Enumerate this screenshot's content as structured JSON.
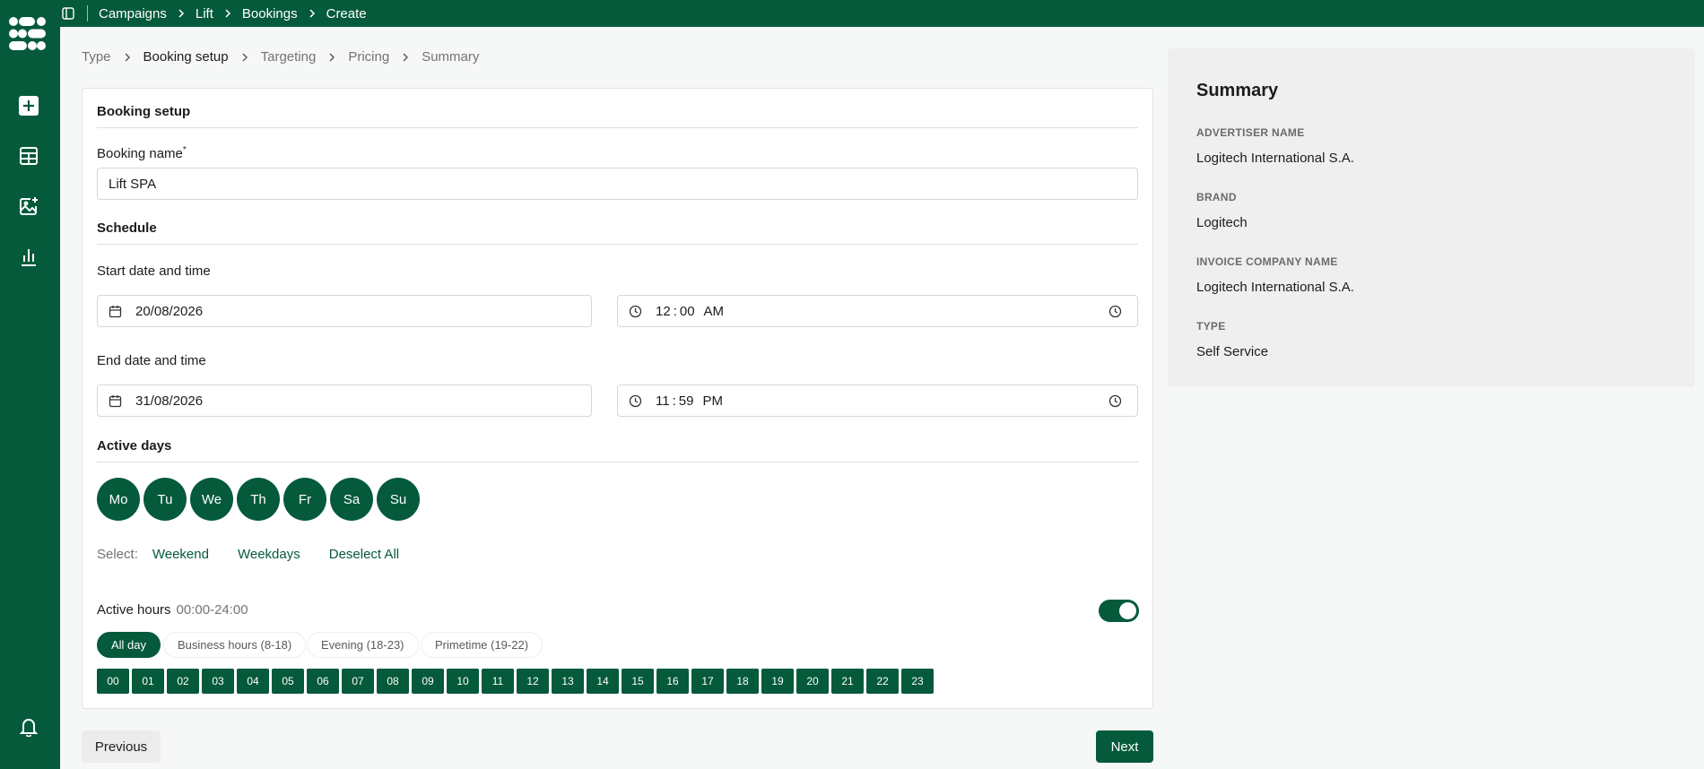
{
  "breadcrumb": [
    "Campaigns",
    "Lift",
    "Bookings",
    "Create"
  ],
  "steps": [
    "Type",
    "Booking setup",
    "Targeting",
    "Pricing",
    "Summary"
  ],
  "active_step": "Booking setup",
  "form": {
    "section_title": "Booking setup",
    "booking_name_label": "Booking name",
    "required_mark": "*",
    "booking_name_value": "Lift SPA",
    "schedule_title": "Schedule",
    "start_label": "Start date and time",
    "start_date": "20/08/2026",
    "start_time_h": "12",
    "start_time_m": "00",
    "start_time_ampm": "AM",
    "end_label": "End date and time",
    "end_date": "31/08/2026",
    "end_time_h": "11",
    "end_time_m": "59",
    "end_time_ampm": "PM",
    "time_separator": ":",
    "active_days_title": "Active days",
    "days": [
      "Mo",
      "Tu",
      "We",
      "Th",
      "Fr",
      "Sa",
      "Su"
    ],
    "select_label": "Select:",
    "select_links": [
      "Weekend",
      "Weekdays",
      "Deselect All"
    ],
    "active_hours_label": "Active hours",
    "active_hours_range": "00:00-24:00",
    "active_hours_enabled": true,
    "presets": [
      "All day",
      "Business hours (8-18)",
      "Evening (18-23)",
      "Primetime (19-22)"
    ],
    "active_preset": "All day",
    "hours": [
      "00",
      "01",
      "02",
      "03",
      "04",
      "05",
      "06",
      "07",
      "08",
      "09",
      "10",
      "11",
      "12",
      "13",
      "14",
      "15",
      "16",
      "17",
      "18",
      "19",
      "20",
      "21",
      "22",
      "23"
    ]
  },
  "buttons": {
    "previous": "Previous",
    "next": "Next"
  },
  "summary": {
    "title": "Summary",
    "items": [
      {
        "key": "ADVERTISER NAME",
        "value": "Logitech International S.A."
      },
      {
        "key": "BRAND",
        "value": "Logitech"
      },
      {
        "key": "INVOICE COMPANY NAME",
        "value": "Logitech International S.A."
      },
      {
        "key": "TYPE",
        "value": "Self Service"
      }
    ]
  },
  "colors": {
    "brand": "#045a3b",
    "background": "#f6f7f7",
    "panel": "#efefef"
  },
  "icons": [
    "app-logo-icon",
    "add-icon",
    "table-icon",
    "image-add-icon",
    "chart-icon",
    "bell-icon",
    "sidebar-panel-icon",
    "chevron-right-icon",
    "calendar-icon",
    "clock-icon"
  ]
}
